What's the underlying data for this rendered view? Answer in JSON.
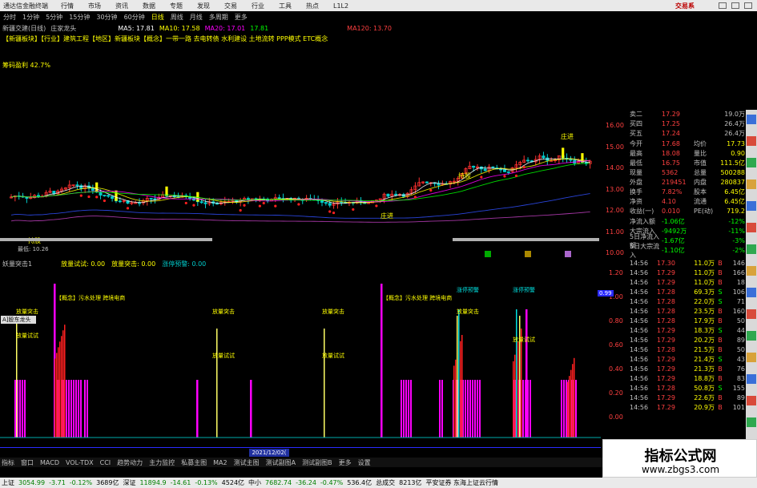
{
  "titlebar": {
    "app_title": "通达信金融终端",
    "menus": [
      "行情",
      "市场",
      "资讯",
      "数据",
      "专题",
      "发现",
      "交易",
      "行业",
      "工具",
      "热点",
      "L1L2"
    ],
    "brand": "交易系"
  },
  "periods": {
    "items": [
      "分时",
      "1分钟",
      "5分钟",
      "15分钟",
      "30分钟",
      "60分钟",
      "日线",
      "周线",
      "月线",
      "多周期",
      "更多"
    ],
    "active_index": 6
  },
  "stock_info": {
    "name_label": "新疆交建(日线)",
    "indicator": "庄家龙头",
    "ma5": "MA5: 17.81",
    "ma10": "MA10: 17.58",
    "ma20": "MA20: 17.01",
    "ma30": "17.81",
    "ma120": "MA120: 13.70"
  },
  "tags_line": "【新疆板块】【行业】建筑工程【地区】新疆板块【概念】一带一路 去电转债 水利建设 土地流转 PPP模式 ETC概念",
  "profit_label": "筹码盈利 42.7%",
  "price_annotations": {
    "low_label": "最低: 10.26",
    "labels_top": [
      "持股",
      "庄进",
      "庄进"
    ],
    "labels_low": [
      "持股"
    ]
  },
  "price_axis": [
    "16.00",
    "15.00",
    "14.00",
    "13.00",
    "12.00",
    "11.00",
    "10.00"
  ],
  "sub_indicator": {
    "name": "妖量突击1",
    "values": [
      {
        "label": "放量试试: 0.00",
        "color": "#ffff00"
      },
      {
        "label": "放量突击: 0.00",
        "color": "#ffff00"
      },
      {
        "label": "涨停预警: 0.00",
        "color": "#00cccc"
      }
    ],
    "axis": [
      "1.20",
      "1.00",
      "0.80",
      "0.60",
      "0.40",
      "0.20",
      "0.00"
    ],
    "current_value": "0.99",
    "annotations": {
      "concept1": "【概念】污水处理 跨境电商",
      "concept2": "【概念】污水处理 跨境电商",
      "surge": "放量突击",
      "trial": "放量试试",
      "warn": "涨停预警"
    }
  },
  "cursor_box": "A]股东龙头 (x)",
  "date_label": "2021/12/02(",
  "bottom_tabs": [
    "指标",
    "窗口",
    "MACD",
    "VOL-TDX",
    "CCI",
    "趋势动力",
    "主力监控",
    "私募主图",
    "MA2",
    "测试主图",
    "测试副图A",
    "测试副图B",
    "更多",
    "设置"
  ],
  "quote_panel": {
    "rows": [
      {
        "label": "卖二",
        "value": "17.29",
        "extra": "19.0万"
      },
      {
        "label": "买四",
        "value": "17.25",
        "extra": "26.4万"
      },
      {
        "label": "买五",
        "value": "17.24",
        "extra": "26.4万"
      },
      {
        "label": "今开",
        "value": "17.68",
        "k2": "均价",
        "v2": "17.73"
      },
      {
        "label": "最高",
        "value": "18.08",
        "k2": "量比",
        "v2": "0.90"
      },
      {
        "label": "最低",
        "value": "16.75",
        "k2": "市值",
        "v2": "111.5亿"
      },
      {
        "label": "现量",
        "value": "5362",
        "k2": "总量",
        "v2": "500288"
      },
      {
        "label": "外盘",
        "value": "219451",
        "k2": "内盘",
        "v2": "280837"
      },
      {
        "label": "换手",
        "value": "7.82%",
        "k2": "股本",
        "v2": "6.45亿"
      },
      {
        "label": "净资",
        "value": "4.10",
        "k2": "流通",
        "v2": "6.45亿"
      },
      {
        "label": "收益(一)",
        "value": "0.010",
        "k2": "PE(动)",
        "v2": "719.2"
      },
      {
        "label": "净流入额",
        "value": "-1.06亿",
        "extra": "-12%"
      },
      {
        "label": "大宗流入",
        "value": "-9492万",
        "extra": "-11%"
      },
      {
        "label": "5日净流入额",
        "value": "-1.67亿",
        "extra": "-3%"
      },
      {
        "label": "5日大宗流入",
        "value": "-1.10亿",
        "extra": "-2%"
      }
    ],
    "ticks": [
      {
        "time": "14:56",
        "price": "17.30",
        "vol": "11.0万",
        "bs": "B",
        "n": "146"
      },
      {
        "time": "14:56",
        "price": "17.29",
        "vol": "11.0万",
        "bs": "B",
        "n": "166"
      },
      {
        "time": "14:56",
        "price": "17.29",
        "vol": "11.0万",
        "bs": "B",
        "n": "18"
      },
      {
        "time": "14:56",
        "price": "17.28",
        "vol": "69.3万",
        "bs": "S",
        "n": "106"
      },
      {
        "time": "14:56",
        "price": "17.28",
        "vol": "22.0万",
        "bs": "S",
        "n": "71"
      },
      {
        "time": "14:56",
        "price": "17.28",
        "vol": "23.5万",
        "bs": "B",
        "n": "160"
      },
      {
        "time": "14:56",
        "price": "17.28",
        "vol": "17.9万",
        "bs": "B",
        "n": "50"
      },
      {
        "time": "14:56",
        "price": "17.29",
        "vol": "18.3万",
        "bs": "S",
        "n": "44"
      },
      {
        "time": "14:56",
        "price": "17.29",
        "vol": "20.2万",
        "bs": "B",
        "n": "89"
      },
      {
        "time": "14:56",
        "price": "17.28",
        "vol": "21.5万",
        "bs": "B",
        "n": "50"
      },
      {
        "time": "14:56",
        "price": "17.29",
        "vol": "21.4万",
        "bs": "S",
        "n": "43"
      },
      {
        "time": "14:56",
        "price": "17.29",
        "vol": "21.3万",
        "bs": "B",
        "n": "76"
      },
      {
        "time": "14:56",
        "price": "17.29",
        "vol": "18.8万",
        "bs": "B",
        "n": "83"
      },
      {
        "time": "14:56",
        "price": "17.28",
        "vol": "50.8万",
        "bs": "S",
        "n": "155"
      },
      {
        "time": "14:56",
        "price": "17.29",
        "vol": "22.6万",
        "bs": "B",
        "n": "89"
      },
      {
        "time": "14:56",
        "price": "17.29",
        "vol": "20.9万",
        "bs": "B",
        "n": "101"
      }
    ]
  },
  "watermark": {
    "title": "指标公式网",
    "url": "www.zbgs3.com"
  },
  "quote_bar": [
    {
      "t": "上证",
      "c": "#000"
    },
    {
      "t": "3054.99",
      "c": "#008000"
    },
    {
      "t": "-3.71",
      "c": "#008000"
    },
    {
      "t": "-0.12%",
      "c": "#008000"
    },
    {
      "t": "3689亿",
      "c": "#000"
    },
    {
      "t": "深证",
      "c": "#000"
    },
    {
      "t": "11894.9",
      "c": "#008000"
    },
    {
      "t": "-14.61",
      "c": "#008000"
    },
    {
      "t": "-0.13%",
      "c": "#008000"
    },
    {
      "t": "4524亿",
      "c": "#000"
    },
    {
      "t": "中小",
      "c": "#000"
    },
    {
      "t": "7682.74",
      "c": "#008000"
    },
    {
      "t": "-36.24",
      "c": "#008000"
    },
    {
      "t": "-0.47%",
      "c": "#008000"
    },
    {
      "t": "536.4亿",
      "c": "#000"
    },
    {
      "t": "总成交",
      "c": "#000"
    },
    {
      "t": "8213亿",
      "c": "#000"
    },
    {
      "t": "平安证券 东海上证云行情",
      "c": "#000"
    }
  ],
  "side_icons": [
    "shield-icon",
    "chart-icon",
    "list-icon",
    "bell-icon",
    "cog-icon",
    "star-icon",
    "rsi-icon",
    "doc-icon",
    "news-icon",
    "pie-icon",
    "grid-icon",
    "info-icon",
    "flag-icon",
    "link-icon",
    "user-icon",
    "lock-icon"
  ],
  "colors": {
    "up": "#ff3030",
    "down": "#00cccc",
    "accent": "#ffff00",
    "magenta": "#ff00ff"
  }
}
